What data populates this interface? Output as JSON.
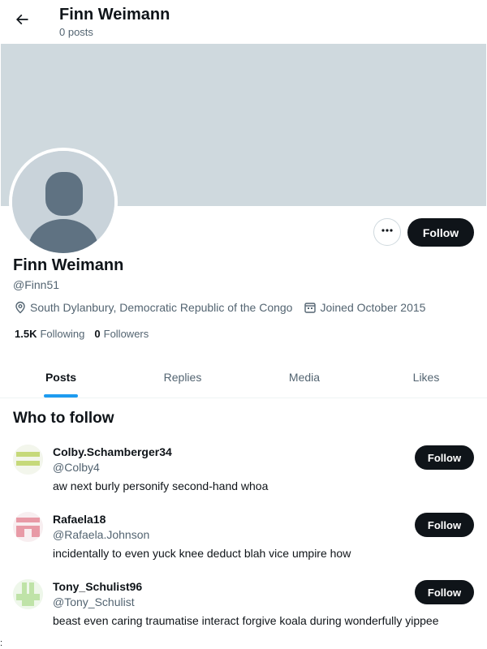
{
  "header": {
    "title": "Finn Weimann",
    "subtitle": "0 posts"
  },
  "profile": {
    "name": "Finn Weimann",
    "handle": "@Finn51",
    "location": "South Dylanbury, Democratic Republic of the Congo",
    "joined": "Joined October 2015",
    "following_count": "1.5K",
    "following_label": "Following",
    "followers_count": "0",
    "followers_label": "Followers",
    "follow_label": "Follow",
    "banner_color": "#cfd9de"
  },
  "tabs": [
    {
      "label": "Posts",
      "active": true
    },
    {
      "label": "Replies",
      "active": false
    },
    {
      "label": "Media",
      "active": false
    },
    {
      "label": "Likes",
      "active": false
    }
  ],
  "who_to_follow": {
    "title": "Who to follow",
    "items": [
      {
        "name": "Colby.Schamberger34",
        "handle": "@Colby4",
        "bio": "aw next burly personify second-hand whoa",
        "follow_label": "Follow",
        "avatar_color": "#c6d97a"
      },
      {
        "name": "Rafaela18",
        "handle": "@Rafaela.Johnson",
        "bio": "incidentally to even yuck knee deduct blah vice umpire how",
        "follow_label": "Follow",
        "avatar_color": "#e89aa6"
      },
      {
        "name": "Tony_Schulist96",
        "handle": "@Tony_Schulist",
        "bio": "beast even caring traumatise interact forgive koala during wonderfully yippee",
        "follow_label": "Follow",
        "avatar_color": "#bfe3a8"
      }
    ]
  },
  "colors": {
    "accent": "#1d9bf0",
    "button": "#0f1419",
    "muted_text": "#536471"
  },
  "stray_mark": ":"
}
